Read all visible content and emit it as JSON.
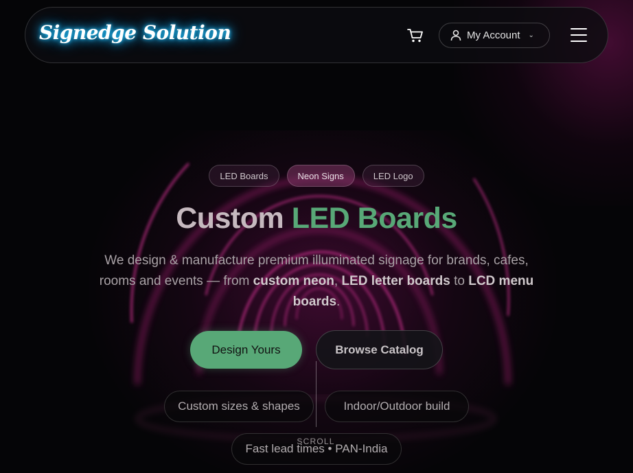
{
  "header": {
    "logo_text": "Signedge Solution",
    "cart_icon": "cart-icon",
    "account_label": "My Account",
    "menu_icon": "hamburger-icon"
  },
  "hero": {
    "tags": [
      {
        "label": "LED Boards"
      },
      {
        "label": "Neon Signs"
      },
      {
        "label": "LED Logo"
      }
    ],
    "headline_part1": "Custom",
    "headline_part2": "LED Boards",
    "subtitle": {
      "text1": "We design & manufacture premium illuminated signage for brands, cafes, rooms and events — from ",
      "bold1": "custom neon",
      "sep1": ", ",
      "bold2": "LED letter boards",
      "text2": " to ",
      "bold3": "LCD menu boards",
      "text3": "."
    },
    "primary_button": "Design Yours",
    "secondary_button": "Browse Catalog",
    "features": [
      "Custom sizes & shapes",
      "Indoor/Outdoor build",
      "Fast lead times • PAN-India"
    ],
    "scroll_label": "SCROLL"
  },
  "colors": {
    "accent_green": "#58a877",
    "logo_glow": "#25c6ff",
    "neon_pink": "#e0359c"
  }
}
